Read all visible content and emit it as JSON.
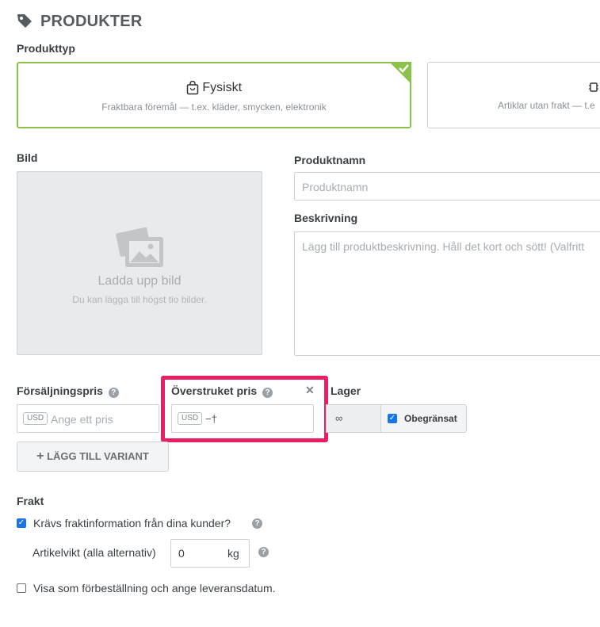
{
  "header": {
    "title": "PRODUKTER",
    "icon": "tag-icon"
  },
  "product_type": {
    "label": "Produkttyp",
    "options": [
      {
        "title": "Fysiskt",
        "subtitle": "Fraktbara föremål — t.ex. kläder, smycken, elektronik",
        "selected": true,
        "icon": "shopping-bag-icon"
      },
      {
        "title": "",
        "subtitle": "Artiklar utan frakt — t.e",
        "selected": false,
        "icon": "digital-icon"
      }
    ]
  },
  "image": {
    "label": "Bild",
    "upload_title": "Ladda upp bild",
    "upload_hint": "Du kan lägga till högst tio bilder."
  },
  "product_name": {
    "label": "Produktnamn",
    "placeholder": "Produktnamn"
  },
  "description": {
    "label": "Beskrivning",
    "placeholder": "Lägg till produktbeskrivning. Håll det kort och sött! (Valfritt"
  },
  "sale_price": {
    "label": "Försäljningspris",
    "currency": "USD",
    "placeholder": "Ange ett pris"
  },
  "compare_price": {
    "label": "Överstruket pris",
    "currency": "USD",
    "value": "−†",
    "close": "✕",
    "highlight_color": "#e91e63"
  },
  "stock": {
    "label": "Lager",
    "value": "∞",
    "unlimited_label": "Obegränsat",
    "unlimited_checked": true
  },
  "add_variant": {
    "label": "LÄGG TILL VARIANT",
    "icon": "+"
  },
  "shipping": {
    "label": "Frakt",
    "require_info_label": "Krävs fraktinformation från dina kunder?",
    "require_info_checked": true,
    "weight_label": "Artikelvikt (alla alternativ)",
    "weight_value": "0",
    "weight_unit": "kg",
    "preorder_label": "Visa som förbeställning och ange leveransdatum.",
    "preorder_checked": false
  },
  "colors": {
    "accent_green": "#8bc34a",
    "checkbox_blue": "#1a73e8",
    "highlight": "#e91e63"
  }
}
